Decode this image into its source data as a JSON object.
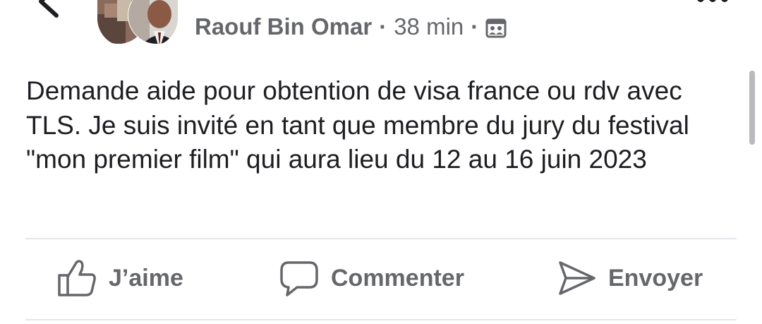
{
  "header": {
    "author_name": "Raouf Bin Omar",
    "separator": "·",
    "time": "38 min",
    "privacy_icon": "group-members-icon",
    "back_icon": "chevron-left-icon",
    "more_icon": "more-dots-icon"
  },
  "post": {
    "text": "Demande aide pour obtention de visa france ou rdv avec TLS. Je suis invité en tant que membre du jury du festival \"mon premier film\" qui aura lieu du 12 au 16 juin 2023"
  },
  "actions": [
    {
      "label": "J’aime",
      "icon": "thumbs-up-icon"
    },
    {
      "label": "Commenter",
      "icon": "comment-bubble-icon"
    },
    {
      "label": "Envoyer",
      "icon": "send-arrow-icon"
    }
  ],
  "colors": {
    "meta_text": "#65676b",
    "body_text": "#1c1e21",
    "divider": "#e4e6eb",
    "scrollbar": "#b8babe"
  }
}
